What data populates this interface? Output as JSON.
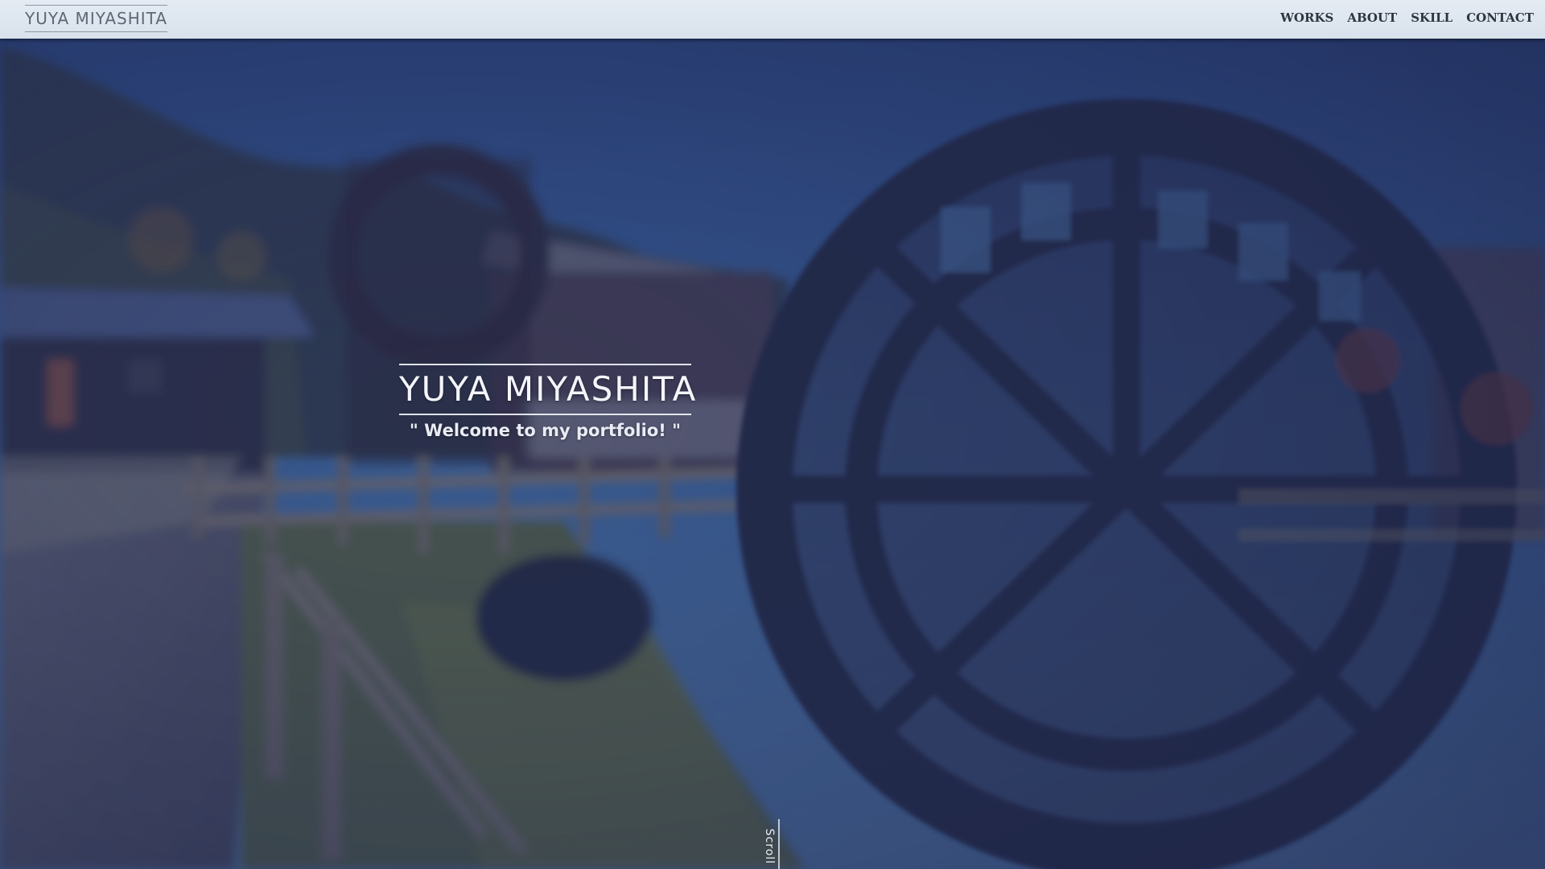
{
  "header": {
    "logo_text": "YUYA MIYASHITA",
    "nav": [
      {
        "label": "WORKS"
      },
      {
        "label": "ABOUT"
      },
      {
        "label": "SKILL"
      },
      {
        "label": "CONTACT"
      }
    ]
  },
  "hero": {
    "title": "YUYA MIYASHITA",
    "subtitle": "\" Welcome to my portfolio! \"",
    "scroll_label": "Scroll",
    "scroll_icon": "arrow-down-icon",
    "background_image": "water-wheel-photo"
  },
  "colors": {
    "header_bg": "#dde5ee",
    "header_text": "#5e6875",
    "nav_text": "#2f3540",
    "overlay": "#2b3564",
    "hero_text": "#f3f5fb"
  }
}
